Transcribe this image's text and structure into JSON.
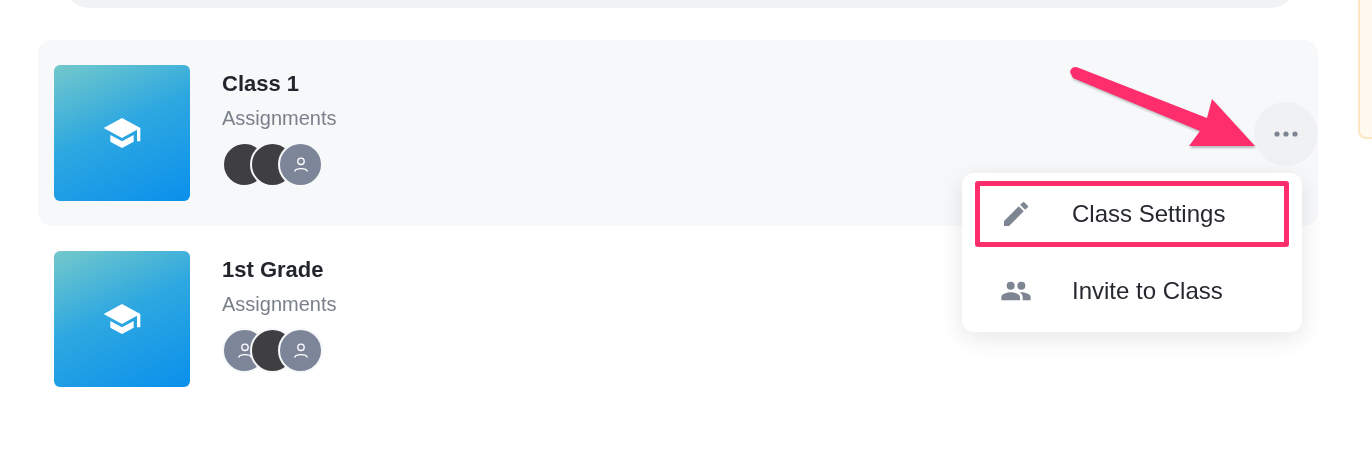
{
  "classes": [
    {
      "title": "Class 1",
      "subtitle": "Assignments",
      "selected": true,
      "avatars": [
        {
          "kind": "photo"
        },
        {
          "kind": "photo"
        },
        {
          "kind": "placeholder"
        }
      ]
    },
    {
      "title": "1st Grade",
      "subtitle": "Assignments",
      "selected": false,
      "avatars": [
        {
          "kind": "placeholder"
        },
        {
          "kind": "photo"
        },
        {
          "kind": "placeholder"
        }
      ]
    }
  ],
  "menu": {
    "items": [
      {
        "label": "Class Settings",
        "highlighted": true
      },
      {
        "label": "Invite to Class",
        "highlighted": false
      }
    ]
  }
}
